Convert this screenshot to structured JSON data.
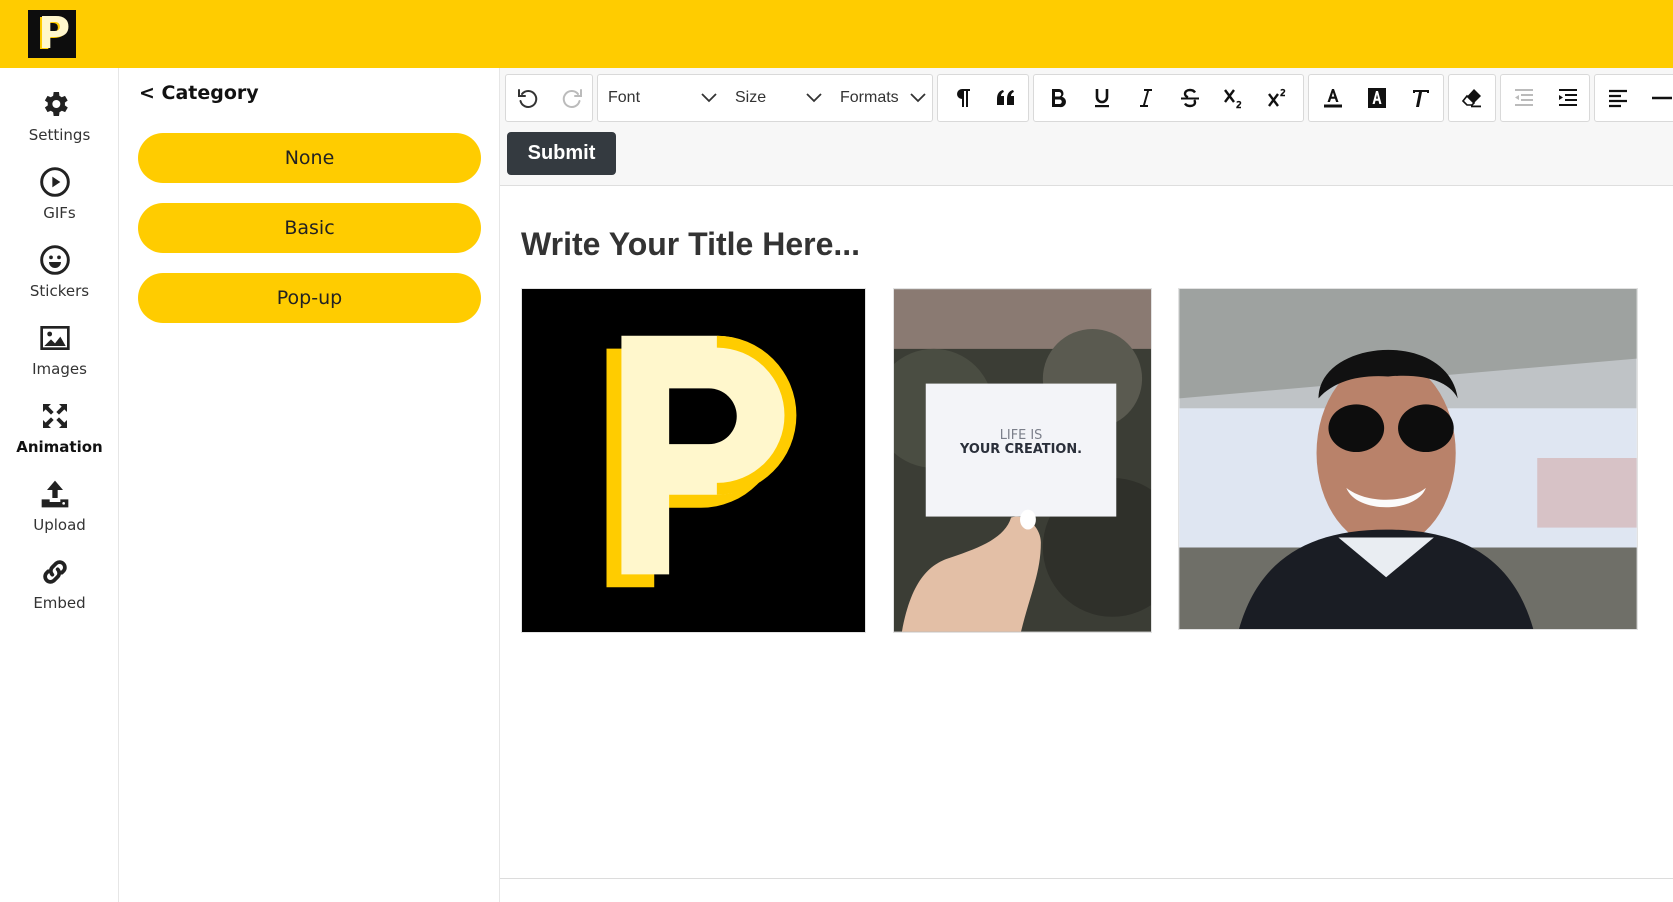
{
  "app": {
    "logo_letter": "P"
  },
  "colors": {
    "brand": "#ffcc00",
    "dark": "#343a40",
    "logo_bg": "#0d0d0d",
    "logo_light": "#fff7cc"
  },
  "sidebar": {
    "items": [
      {
        "label": "Settings",
        "icon": "gear-icon"
      },
      {
        "label": "GIFs",
        "icon": "play-circle-icon"
      },
      {
        "label": "Stickers",
        "icon": "smiley-icon"
      },
      {
        "label": "Images",
        "icon": "image-icon"
      },
      {
        "label": "Animation",
        "icon": "expand-arrows-icon",
        "active": true
      },
      {
        "label": "Upload",
        "icon": "upload-icon"
      },
      {
        "label": "Embed",
        "icon": "link-icon"
      }
    ]
  },
  "panel": {
    "title": "< Category",
    "categories": [
      "None",
      "Basic",
      "Pop-up"
    ]
  },
  "toolbar": {
    "font_label": "Font",
    "size_label": "Size",
    "formats_label": "Formats",
    "submit_label": "Submit"
  },
  "document": {
    "title": "Write Your Title Here...",
    "images": [
      {
        "name": "p-logo-image",
        "description_icon": "logo"
      },
      {
        "name": "card-photo-image",
        "card_line1": "LIFE IS",
        "card_line2": "YOUR CREATION."
      },
      {
        "name": "aviator-gif-image"
      }
    ]
  }
}
